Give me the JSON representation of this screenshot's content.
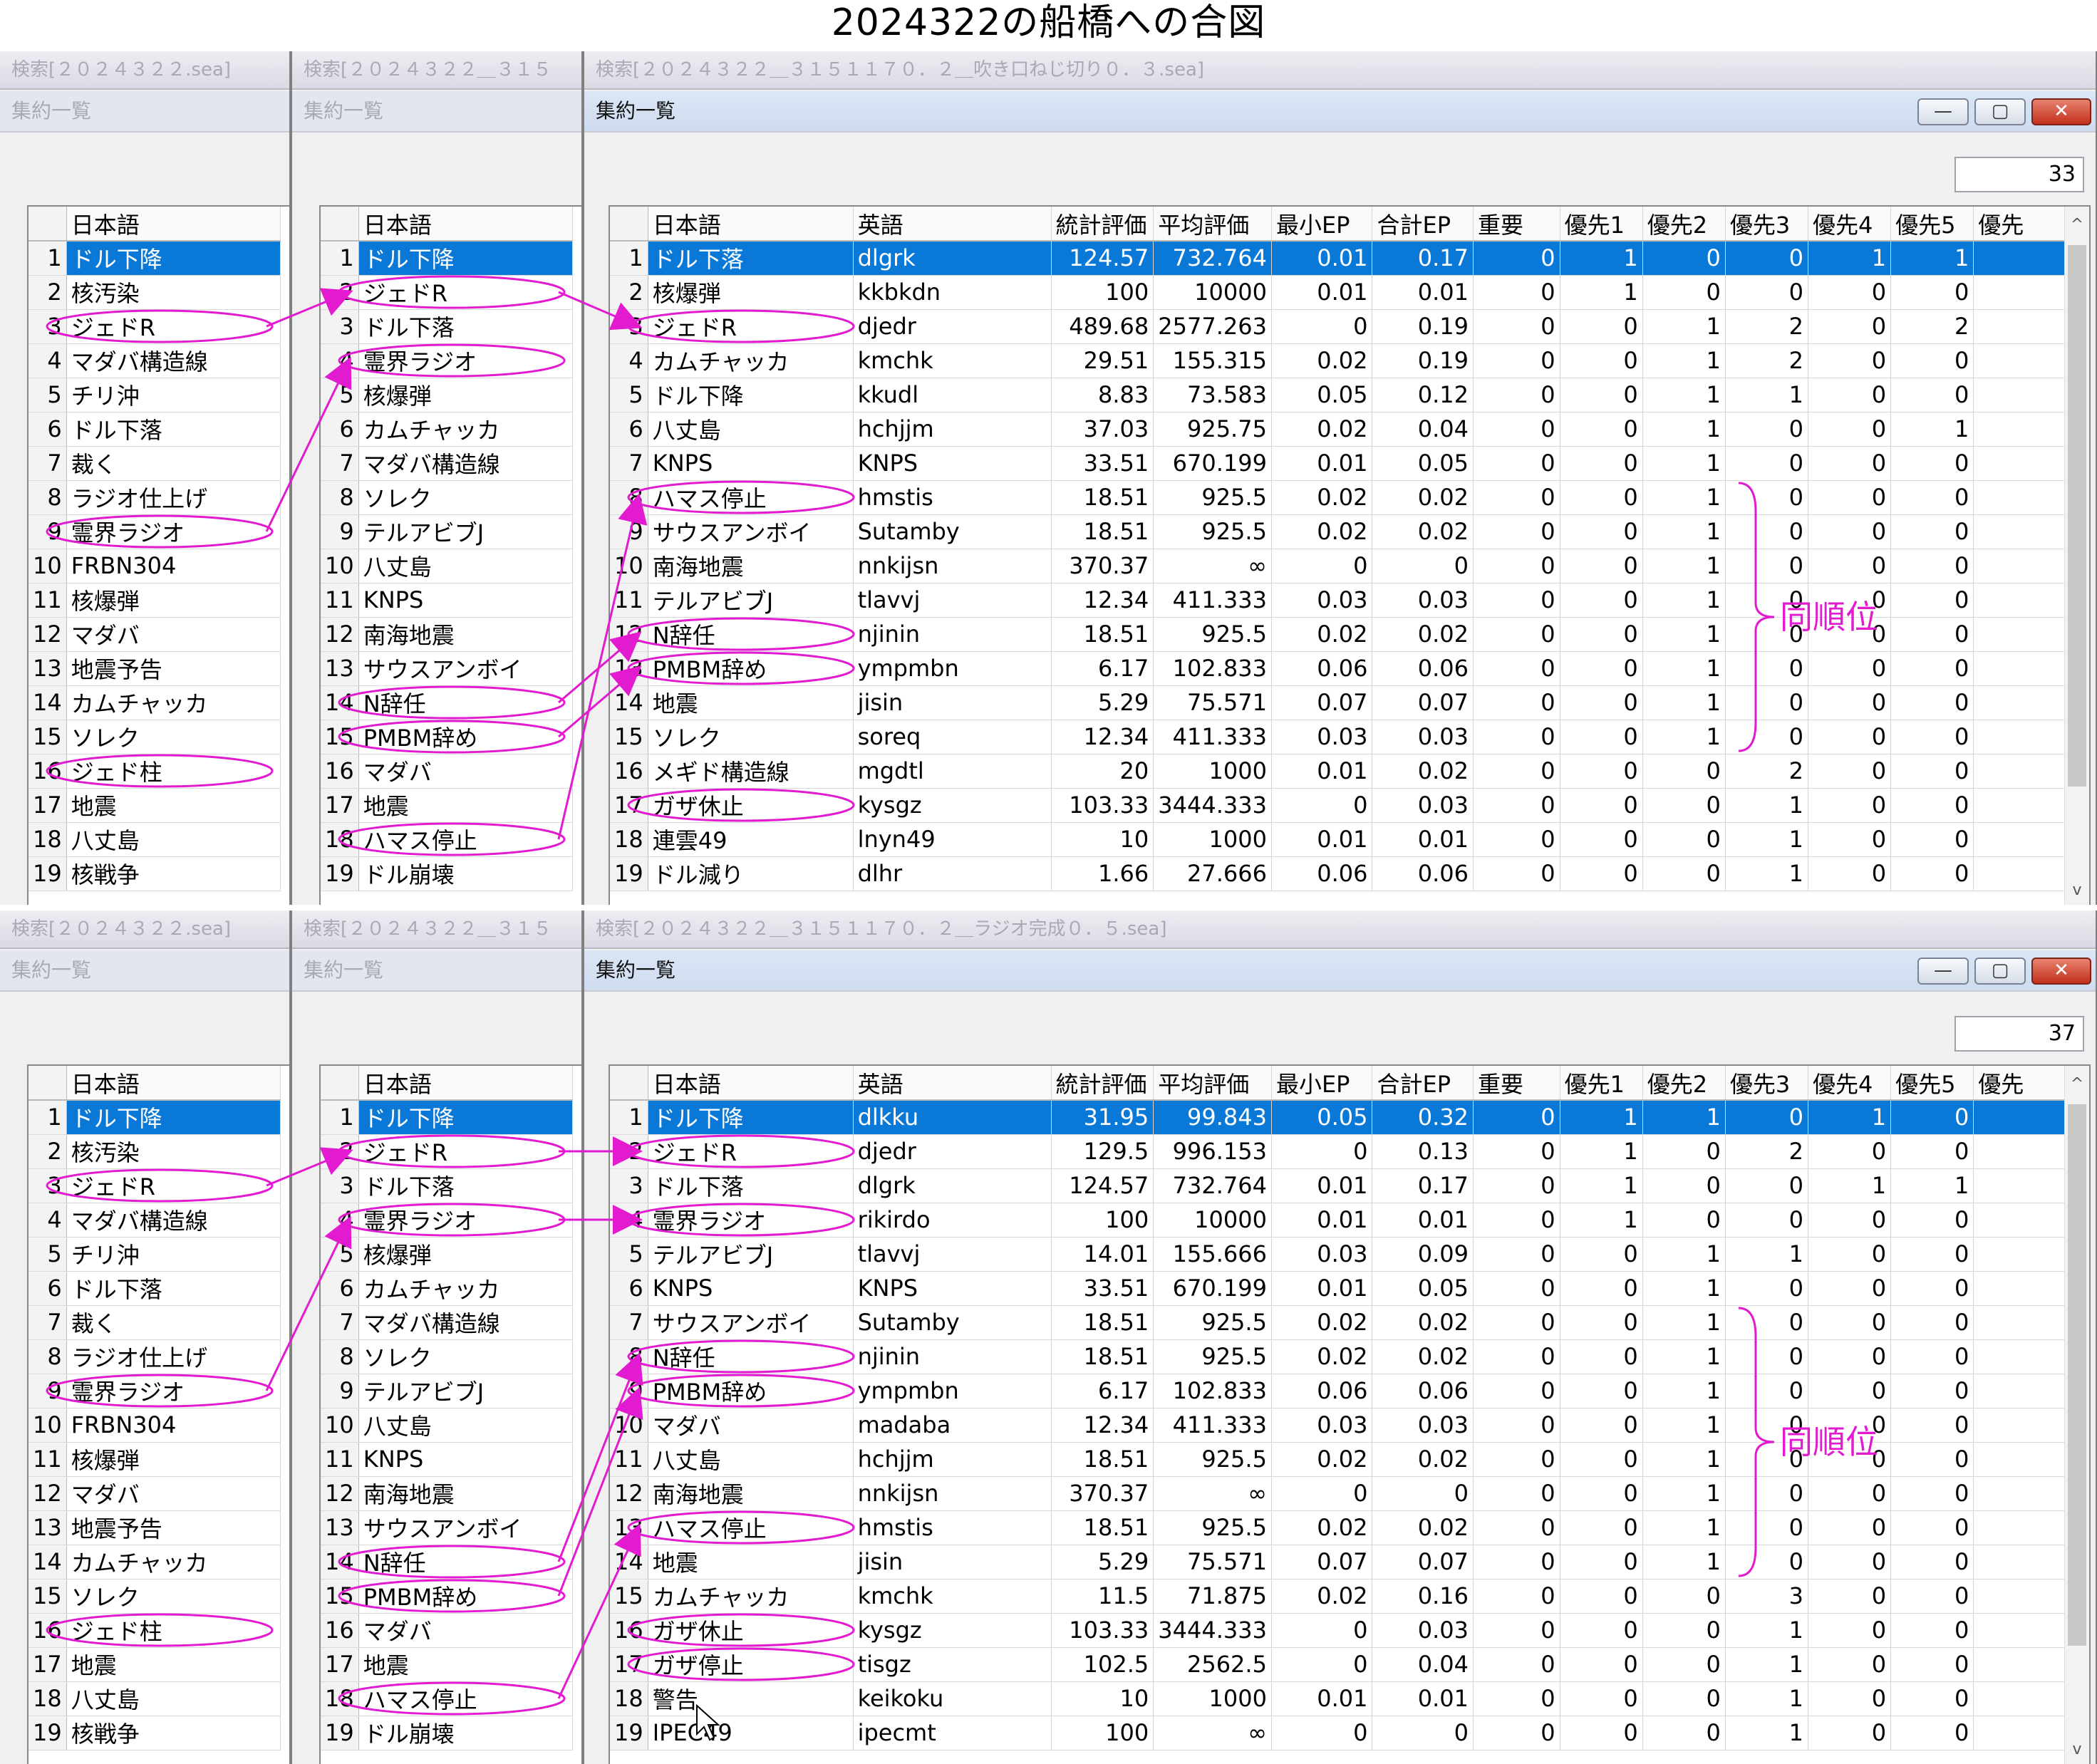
{
  "title": "2024322の船橋への合図",
  "icons": {
    "minimize": "minimize-icon",
    "maximize": "maximize-icon",
    "close": "close-icon",
    "scroll_up": "scroll-up-icon",
    "scroll_down": "scroll-down-icon"
  },
  "colors": {
    "selection": "#0a78d7",
    "annotation": "#e21ad0"
  },
  "left_list": {
    "header": "日本語",
    "rows": [
      "ドル下降",
      "核汚染",
      "ジェドR",
      "マダバ構造線",
      "チリ沖",
      "ドル下落",
      "裁く",
      "ラジオ仕上げ",
      "霊界ラジオ",
      "FRBN304",
      "核爆弾",
      "マダバ",
      "地震予告",
      "カムチャッカ",
      "ソレク",
      "ジェド柱",
      "地震",
      "八丈島",
      "核戦争"
    ]
  },
  "mid_list": {
    "header": "日本語",
    "rows": [
      "ドル下降",
      "ジェドR",
      "ドル下落",
      "霊界ラジオ",
      "核爆弾",
      "カムチャッカ",
      "マダバ構造線",
      "ソレク",
      "テルアビブJ",
      "八丈島",
      "KNPS",
      "南海地震",
      "サウスアンボイ",
      "N辞任",
      "PMBM辞め",
      "マダバ",
      "地震",
      "ハマス停止",
      "ドル崩壊"
    ]
  },
  "columns": [
    "日本語",
    "英語",
    "統計評価",
    "平均評価",
    "最小EP",
    "合計EP",
    "重要",
    "優先1",
    "優先2",
    "優先3",
    "優先4",
    "優先5",
    "優先"
  ],
  "panels": [
    {
      "win1_caption": "検索[２０２４３２２.sea]",
      "win2_caption": "検索[２０２４３２２＿３１５",
      "win3_caption": "検索[２０２４３２２＿３１５１１７０．２＿吹き口ねじ切り０．３.sea]",
      "menu_label": "集約一覧",
      "count": "33",
      "note": "同順位",
      "rows": [
        [
          "ドル下落",
          "dlgrk",
          "124.57",
          "732.764",
          "0.01",
          "0.17",
          "0",
          "1",
          "0",
          "0",
          "1",
          "1"
        ],
        [
          "核爆弾",
          "kkbkdn",
          "100",
          "10000",
          "0.01",
          "0.01",
          "0",
          "1",
          "0",
          "0",
          "0",
          "0"
        ],
        [
          "ジェドR",
          "djedr",
          "489.68",
          "2577.263",
          "0",
          "0.19",
          "0",
          "0",
          "1",
          "2",
          "0",
          "2"
        ],
        [
          "カムチャッカ",
          "kmchk",
          "29.51",
          "155.315",
          "0.02",
          "0.19",
          "0",
          "0",
          "1",
          "2",
          "0",
          "0"
        ],
        [
          "ドル下降",
          "kkudl",
          "8.83",
          "73.583",
          "0.05",
          "0.12",
          "0",
          "0",
          "1",
          "1",
          "0",
          "0"
        ],
        [
          "八丈島",
          "hchjjm",
          "37.03",
          "925.75",
          "0.02",
          "0.04",
          "0",
          "0",
          "1",
          "0",
          "0",
          "1"
        ],
        [
          "KNPS",
          "KNPS",
          "33.51",
          "670.199",
          "0.01",
          "0.05",
          "0",
          "0",
          "1",
          "0",
          "0",
          "0"
        ],
        [
          "ハマス停止",
          "hmstis",
          "18.51",
          "925.5",
          "0.02",
          "0.02",
          "0",
          "0",
          "1",
          "0",
          "0",
          "0"
        ],
        [
          "サウスアンボイ",
          "Sutamby",
          "18.51",
          "925.5",
          "0.02",
          "0.02",
          "0",
          "0",
          "1",
          "0",
          "0",
          "0"
        ],
        [
          "南海地震",
          "nnkijsn",
          "370.37",
          "∞",
          "0",
          "0",
          "0",
          "0",
          "1",
          "0",
          "0",
          "0"
        ],
        [
          "テルアビブJ",
          "tlavvj",
          "12.34",
          "411.333",
          "0.03",
          "0.03",
          "0",
          "0",
          "1",
          "0",
          "0",
          "0"
        ],
        [
          "N辞任",
          "njinin",
          "18.51",
          "925.5",
          "0.02",
          "0.02",
          "0",
          "0",
          "1",
          "0",
          "0",
          "0"
        ],
        [
          "PMBM辞め",
          "ympmbn",
          "6.17",
          "102.833",
          "0.06",
          "0.06",
          "0",
          "0",
          "1",
          "0",
          "0",
          "0"
        ],
        [
          "地震",
          "jisin",
          "5.29",
          "75.571",
          "0.07",
          "0.07",
          "0",
          "0",
          "1",
          "0",
          "0",
          "0"
        ],
        [
          "ソレク",
          "soreq",
          "12.34",
          "411.333",
          "0.03",
          "0.03",
          "0",
          "0",
          "1",
          "0",
          "0",
          "0"
        ],
        [
          "メギド構造線",
          "mgdtl",
          "20",
          "1000",
          "0.01",
          "0.02",
          "0",
          "0",
          "0",
          "2",
          "0",
          "0"
        ],
        [
          "ガザ休止",
          "kysgz",
          "103.33",
          "3444.333",
          "0",
          "0.03",
          "0",
          "0",
          "0",
          "1",
          "0",
          "0"
        ],
        [
          "連雲49",
          "lnyn49",
          "10",
          "1000",
          "0.01",
          "0.01",
          "0",
          "0",
          "0",
          "1",
          "0",
          "0"
        ],
        [
          "ドル減り",
          "dlhr",
          "1.66",
          "27.666",
          "0.06",
          "0.06",
          "0",
          "0",
          "0",
          "1",
          "0",
          "0"
        ]
      ]
    },
    {
      "win1_caption": "検索[２０２４３２２.sea]",
      "win2_caption": "検索[２０２４３２２＿３１５",
      "win3_caption": "検索[２０２４３２２＿３１５１１７０．２＿ラジオ完成０．５.sea]",
      "menu_label": "集約一覧",
      "count": "37",
      "note": "同順位",
      "rows": [
        [
          "ドル下降",
          "dlkku",
          "31.95",
          "99.843",
          "0.05",
          "0.32",
          "0",
          "1",
          "1",
          "0",
          "1",
          "0"
        ],
        [
          "ジェドR",
          "djedr",
          "129.5",
          "996.153",
          "0",
          "0.13",
          "0",
          "1",
          "0",
          "2",
          "0",
          "0"
        ],
        [
          "ドル下落",
          "dlgrk",
          "124.57",
          "732.764",
          "0.01",
          "0.17",
          "0",
          "1",
          "0",
          "0",
          "1",
          "1"
        ],
        [
          "霊界ラジオ",
          "rikirdo",
          "100",
          "10000",
          "0.01",
          "0.01",
          "0",
          "1",
          "0",
          "0",
          "0",
          "0"
        ],
        [
          "テルアビブJ",
          "tlavvj",
          "14.01",
          "155.666",
          "0.03",
          "0.09",
          "0",
          "0",
          "1",
          "1",
          "0",
          "0"
        ],
        [
          "KNPS",
          "KNPS",
          "33.51",
          "670.199",
          "0.01",
          "0.05",
          "0",
          "0",
          "1",
          "0",
          "0",
          "0"
        ],
        [
          "サウスアンボイ",
          "Sutamby",
          "18.51",
          "925.5",
          "0.02",
          "0.02",
          "0",
          "0",
          "1",
          "0",
          "0",
          "0"
        ],
        [
          "N辞任",
          "njinin",
          "18.51",
          "925.5",
          "0.02",
          "0.02",
          "0",
          "0",
          "1",
          "0",
          "0",
          "0"
        ],
        [
          "PMBM辞め",
          "ympmbn",
          "6.17",
          "102.833",
          "0.06",
          "0.06",
          "0",
          "0",
          "1",
          "0",
          "0",
          "0"
        ],
        [
          "マダバ",
          "madaba",
          "12.34",
          "411.333",
          "0.03",
          "0.03",
          "0",
          "0",
          "1",
          "0",
          "0",
          "0"
        ],
        [
          "八丈島",
          "hchjjm",
          "18.51",
          "925.5",
          "0.02",
          "0.02",
          "0",
          "0",
          "1",
          "0",
          "0",
          "0"
        ],
        [
          "南海地震",
          "nnkijsn",
          "370.37",
          "∞",
          "0",
          "0",
          "0",
          "0",
          "1",
          "0",
          "0",
          "0"
        ],
        [
          "ハマス停止",
          "hmstis",
          "18.51",
          "925.5",
          "0.02",
          "0.02",
          "0",
          "0",
          "1",
          "0",
          "0",
          "0"
        ],
        [
          "地震",
          "jisin",
          "5.29",
          "75.571",
          "0.07",
          "0.07",
          "0",
          "0",
          "1",
          "0",
          "0",
          "0"
        ],
        [
          "カムチャッカ",
          "kmchk",
          "11.5",
          "71.875",
          "0.02",
          "0.16",
          "0",
          "0",
          "0",
          "3",
          "0",
          "0"
        ],
        [
          "ガザ休止",
          "kysgz",
          "103.33",
          "3444.333",
          "0",
          "0.03",
          "0",
          "0",
          "0",
          "1",
          "0",
          "0"
        ],
        [
          "ガザ停止",
          "tisgz",
          "102.5",
          "2562.5",
          "0",
          "0.04",
          "0",
          "0",
          "0",
          "1",
          "0",
          "0"
        ],
        [
          "警告",
          "keikoku",
          "10",
          "1000",
          "0.01",
          "0.01",
          "0",
          "0",
          "0",
          "1",
          "0",
          "0"
        ],
        [
          "IPEC49",
          "ipecmt",
          "100",
          "∞",
          "0",
          "0",
          "0",
          "0",
          "0",
          "1",
          "0",
          "0"
        ]
      ]
    }
  ]
}
